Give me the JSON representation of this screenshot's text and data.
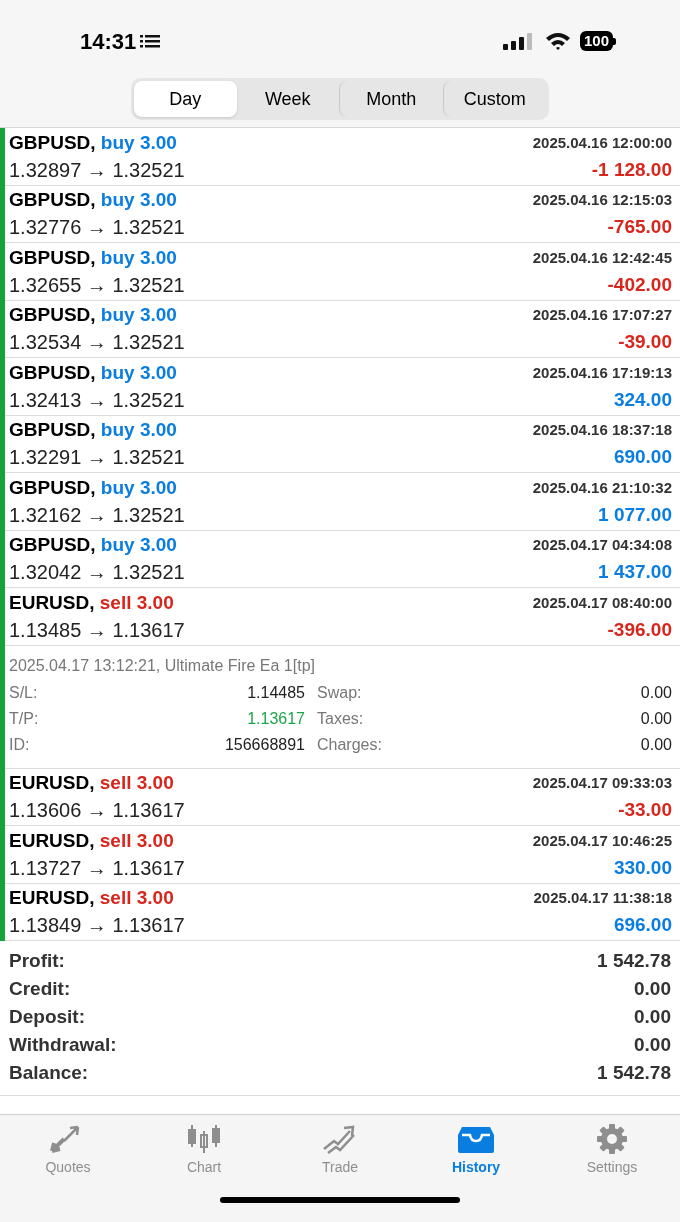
{
  "status_bar": {
    "time": "14:31",
    "battery": "100"
  },
  "tabs": [
    {
      "label": "Day",
      "selected": true
    },
    {
      "label": "Week",
      "selected": false
    },
    {
      "label": "Month",
      "selected": false
    },
    {
      "label": "Custom",
      "selected": false
    }
  ],
  "trades": [
    {
      "symbol": "GBPUSD,",
      "order": {
        "text": "buy 3.00",
        "color": "#0a7ee0"
      },
      "prices": "1.32897 → 1.32521",
      "time": "2025.04.16 12:00:00",
      "profit": {
        "text": "-1 128.00",
        "color": "#d9261c"
      }
    },
    {
      "symbol": "GBPUSD,",
      "order": {
        "text": "buy 3.00",
        "color": "#0a7ee0"
      },
      "prices": "1.32776 → 1.32521",
      "time": "2025.04.16 12:15:03",
      "profit": {
        "text": "-765.00",
        "color": "#d9261c"
      }
    },
    {
      "symbol": "GBPUSD,",
      "order": {
        "text": "buy 3.00",
        "color": "#0a7ee0"
      },
      "prices": "1.32655 → 1.32521",
      "time": "2025.04.16 12:42:45",
      "profit": {
        "text": "-402.00",
        "color": "#d9261c"
      }
    },
    {
      "symbol": "GBPUSD,",
      "order": {
        "text": "buy 3.00",
        "color": "#0a7ee0"
      },
      "prices": "1.32534 → 1.32521",
      "time": "2025.04.16 17:07:27",
      "profit": {
        "text": "-39.00",
        "color": "#d9261c"
      }
    },
    {
      "symbol": "GBPUSD,",
      "order": {
        "text": "buy 3.00",
        "color": "#0a7ee0"
      },
      "prices": "1.32413 → 1.32521",
      "time": "2025.04.16 17:19:13",
      "profit": {
        "text": "324.00",
        "color": "#0a7ee0"
      }
    },
    {
      "symbol": "GBPUSD,",
      "order": {
        "text": "buy 3.00",
        "color": "#0a7ee0"
      },
      "prices": "1.32291 → 1.32521",
      "time": "2025.04.16 18:37:18",
      "profit": {
        "text": "690.00",
        "color": "#0a7ee0"
      }
    },
    {
      "symbol": "GBPUSD,",
      "order": {
        "text": "buy 3.00",
        "color": "#0a7ee0"
      },
      "prices": "1.32162 → 1.32521",
      "time": "2025.04.16 21:10:32",
      "profit": {
        "text": "1 077.00",
        "color": "#0a7ee0"
      }
    },
    {
      "symbol": "GBPUSD,",
      "order": {
        "text": "buy 3.00",
        "color": "#0a7ee0"
      },
      "prices": "1.32042 → 1.32521",
      "time": "2025.04.17 04:34:08",
      "profit": {
        "text": "1 437.00",
        "color": "#0a7ee0"
      }
    },
    {
      "symbol": "EURUSD,",
      "order": {
        "text": "sell 3.00",
        "color": "#d9261c"
      },
      "prices": "1.13485 → 1.13617",
      "time": "2025.04.17 08:40:00",
      "profit": {
        "text": "-396.00",
        "color": "#d9261c"
      },
      "details": {
        "comment": "2025.04.17 13:12:21, Ultimate Fire Ea 1[tp]",
        "fields": [
          {
            "label": "S/L:",
            "value": {
              "text": "1.14485",
              "color": "#222222"
            },
            "label2": "Swap:",
            "value2": "0.00"
          },
          {
            "label": "T/P:",
            "value": {
              "text": "1.13617",
              "color": "#1ea54a"
            },
            "label2": "Taxes:",
            "value2": "0.00"
          },
          {
            "label": "ID:",
            "value": {
              "text": "156668891",
              "color": "#222222"
            },
            "label2": "Charges:",
            "value2": "0.00"
          }
        ]
      }
    },
    {
      "symbol": "EURUSD,",
      "order": {
        "text": "sell 3.00",
        "color": "#d9261c"
      },
      "prices": "1.13606 → 1.13617",
      "time": "2025.04.17 09:33:03",
      "profit": {
        "text": "-33.00",
        "color": "#d9261c"
      }
    },
    {
      "symbol": "EURUSD,",
      "order": {
        "text": "sell 3.00",
        "color": "#d9261c"
      },
      "prices": "1.13727 → 1.13617",
      "time": "2025.04.17 10:46:25",
      "profit": {
        "text": "330.00",
        "color": "#0a7ee0"
      }
    },
    {
      "symbol": "EURUSD,",
      "order": {
        "text": "sell 3.00",
        "color": "#d9261c"
      },
      "prices": "1.13849 → 1.13617",
      "time": "2025.04.17 11:38:18",
      "profit": {
        "text": "696.00",
        "color": "#0a7ee0"
      }
    }
  ],
  "summary": [
    {
      "label": "Profit:",
      "value": "1 542.78"
    },
    {
      "label": "Credit:",
      "value": "0.00"
    },
    {
      "label": "Deposit:",
      "value": "0.00"
    },
    {
      "label": "Withdrawal:",
      "value": "0.00"
    },
    {
      "label": "Balance:",
      "value": "1 542.78"
    }
  ],
  "tab_bar": [
    {
      "label": "Quotes",
      "selected": false
    },
    {
      "label": "Chart",
      "selected": false
    },
    {
      "label": "Trade",
      "selected": false
    },
    {
      "label": "History",
      "selected": true
    },
    {
      "label": "Settings",
      "selected": false
    }
  ]
}
